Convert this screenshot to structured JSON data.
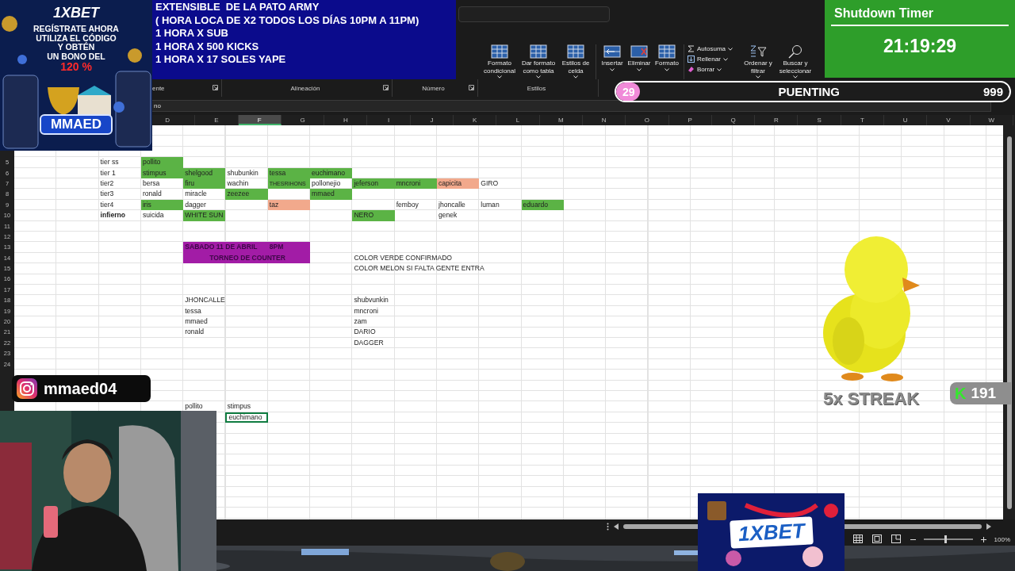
{
  "announcement": {
    "lines": [
      "EXTENSIBLE  DE LA PATO ARMY",
      "( HORA LOCA DE X2 TODOS LOS DÍAS 10PM A 11PM)",
      "1 HORA X SUB",
      "1 HORA X 500 KICKS",
      "1 HORA X 17 SOLES YAPE"
    ]
  },
  "promo_banner": {
    "logo": "1XBET",
    "lines": [
      "REGÍSTRATE AHORA",
      "UTILIZA EL CÓDIGO",
      "Y OBTÉN",
      "UN BONO DEL"
    ],
    "highlight": "120 %",
    "code": "MMAED"
  },
  "timer": {
    "title": "Shutdown Timer",
    "time": "21:19:29"
  },
  "goal_bar": {
    "count": "29",
    "label": "PUENTING",
    "goal": "999",
    "level": 0.06
  },
  "ribbon": {
    "commands": [
      {
        "kind": "grid",
        "label": "Formato condicional"
      },
      {
        "kind": "grid",
        "label": "Dar formato como tabla"
      },
      {
        "kind": "grid",
        "label": "Estilos de celda"
      },
      {
        "kind": "insert",
        "label": "Insertar"
      },
      {
        "kind": "delete",
        "label": "Eliminar"
      },
      {
        "kind": "grid",
        "label": "Formato"
      }
    ],
    "edit_items": [
      {
        "kind": "sum",
        "label": "Autosuma"
      },
      {
        "kind": "fill",
        "label": "Rellenar"
      },
      {
        "kind": "clear",
        "label": "Borrar"
      }
    ],
    "edit_commands": [
      {
        "kind": "sort",
        "label": "Ordenar y filtrar"
      },
      {
        "kind": "find",
        "label": "Buscar y seleccionar"
      }
    ],
    "groups": [
      "ente",
      "Alineación",
      "Número",
      "Estilos"
    ]
  },
  "formula_bar": {
    "value": "no"
  },
  "columns": [
    {
      "label": "D",
      "selected": false
    },
    {
      "label": "E",
      "selected": false
    },
    {
      "label": "F",
      "selected": true
    },
    {
      "label": "G",
      "selected": false
    },
    {
      "label": "H",
      "selected": false
    },
    {
      "label": "I",
      "selected": false
    },
    {
      "label": "J",
      "selected": false
    },
    {
      "label": "K",
      "selected": false
    },
    {
      "label": "L",
      "selected": false
    },
    {
      "label": "M",
      "selected": false
    },
    {
      "label": "N",
      "selected": false
    },
    {
      "label": "O",
      "selected": false
    },
    {
      "label": "P",
      "selected": false
    },
    {
      "label": "Q",
      "selected": false
    },
    {
      "label": "R",
      "selected": false
    },
    {
      "label": "S",
      "selected": false
    },
    {
      "label": "T",
      "selected": false
    },
    {
      "label": "U",
      "selected": false
    },
    {
      "label": "V",
      "selected": false
    },
    {
      "label": "W",
      "selected": false
    }
  ],
  "rows": [
    {
      "number": "5",
      "cells": [
        {
          "kind": "text",
          "text": "tier ss",
          "selected": false
        },
        {
          "kind": "text",
          "text": "pollito",
          "color": "#5bb345",
          "selected": false
        }
      ]
    },
    {
      "number": "6",
      "cells": [
        {
          "kind": "text",
          "text": "tier 1",
          "selected": false
        },
        {
          "kind": "text",
          "text": "stimpus",
          "color": "#5bb345",
          "selected": false
        },
        {
          "kind": "text",
          "text": "shelgood",
          "color": "#5bb345",
          "selected": false
        },
        {
          "kind": "text",
          "text": "shubunkin",
          "selected": false
        },
        {
          "kind": "text",
          "text": "tessa",
          "color": "#5bb345",
          "selected": false
        },
        {
          "kind": "text",
          "text": "euchimano",
          "color": "#5bb345",
          "selected": false
        }
      ]
    },
    {
      "number": "7",
      "cells": [
        {
          "kind": "text",
          "text": "tier2",
          "selected": false
        },
        {
          "kind": "text",
          "text": "bersa",
          "selected": false
        },
        {
          "kind": "text",
          "text": "firu",
          "color": "#5bb345",
          "selected": false
        },
        {
          "kind": "text",
          "text": "wachin",
          "selected": false
        },
        {
          "kind": "text",
          "text": "THESRIHONS",
          "color": "#5bb345",
          "selected": false
        },
        {
          "kind": "text",
          "text": "pollonejio",
          "selected": false
        },
        {
          "kind": "text",
          "text": "jeferson",
          "color": "#5bb345",
          "selected": false
        },
        {
          "kind": "text",
          "text": "mncroni",
          "color": "#5bb345",
          "selected": false
        },
        {
          "kind": "text",
          "text": "capicita",
          "color": "#f2a98c",
          "selected": false
        },
        {
          "kind": "text",
          "text": "GIRO",
          "selected": false
        }
      ]
    },
    {
      "number": "8",
      "cells": [
        {
          "kind": "text",
          "text": "tier3",
          "selected": false
        },
        {
          "kind": "text",
          "text": "ronald",
          "selected": false
        },
        {
          "kind": "text",
          "text": "miracle",
          "selected": false
        },
        {
          "kind": "text",
          "text": "zeezee",
          "color": "#5bb345",
          "selected": false
        },
        {
          "kind": "empty"
        },
        {
          "kind": "text",
          "text": "mmaed",
          "color": "#5bb345",
          "selected": false
        }
      ]
    },
    {
      "number": "9",
      "cells": [
        {
          "kind": "text",
          "text": "tier4",
          "selected": false
        },
        {
          "kind": "text",
          "text": "iris",
          "color": "#5bb345",
          "selected": false
        },
        {
          "kind": "text",
          "text": "dagger",
          "selected": false
        },
        {
          "kind": "empty"
        },
        {
          "kind": "text",
          "text": "taz",
          "color": "#f2a98c",
          "selected": false
        },
        {
          "kind": "empty"
        },
        {
          "kind": "empty"
        },
        {
          "kind": "text",
          "text": "femboy",
          "selected": false
        },
        {
          "kind": "text",
          "text": "jhoncalle",
          "selected": false
        },
        {
          "kind": "text",
          "text": "luman",
          "selected": false
        },
        {
          "kind": "text",
          "text": "eduardo",
          "color": "#5bb345",
          "selected": false
        }
      ]
    },
    {
      "number": "10",
      "cells": [
        {
          "kind": "text",
          "text": "infierno",
          "bold": true,
          "selected": false
        },
        {
          "kind": "text",
          "text": "suicida",
          "selected": false
        },
        {
          "kind": "text",
          "text": "WHITE SUN",
          "color": "#5bb345",
          "selected": false
        },
        {
          "kind": "empty"
        },
        {
          "kind": "empty"
        },
        {
          "kind": "empty"
        },
        {
          "kind": "text",
          "text": "NERO",
          "color": "#5bb345",
          "selected": false
        },
        {
          "kind": "empty"
        },
        {
          "kind": "text",
          "text": "genek",
          "selected": false
        }
      ]
    },
    {
      "number": "11"
    },
    {
      "number": "12"
    },
    {
      "number": "13",
      "cells": [
        {
          "kind": "empty"
        },
        {
          "kind": "empty"
        },
        {
          "kind": "double",
          "text": "SABADO 11 DE ABRIL",
          "color": "#a21ca6",
          "bold": true,
          "selected": false
        },
        {
          "kind": "text",
          "text": "8PM",
          "color": "#a21ca6",
          "bold": true,
          "selected": false
        }
      ]
    },
    {
      "number": "14",
      "cells": [
        {
          "kind": "empty"
        },
        {
          "kind": "empty"
        },
        {
          "kind": "triple",
          "text": "TORNEO DE COUNTER",
          "color": "#a21ca6",
          "bold": true,
          "selected": false
        },
        {
          "kind": "empty"
        },
        {
          "kind": "text",
          "text": "COLOR VERDE CONFIRMADO",
          "selected": false
        }
      ]
    },
    {
      "number": "15",
      "cells": [
        {
          "kind": "empty"
        },
        {
          "kind": "empty"
        },
        {
          "kind": "empty"
        },
        {
          "kind": "empty"
        },
        {
          "kind": "empty"
        },
        {
          "kind": "empty"
        },
        {
          "kind": "text",
          "text": "COLOR MELON SI FALTA GENTE ENTRA",
          "selected": false
        }
      ]
    },
    {
      "number": "16"
    },
    {
      "number": "17"
    },
    {
      "number": "18",
      "cells": [
        {
          "kind": "empty"
        },
        {
          "kind": "empty"
        },
        {
          "kind": "text",
          "text": "JHONCALLE",
          "selected": false
        },
        {
          "kind": "empty"
        },
        {
          "kind": "empty"
        },
        {
          "kind": "empty"
        },
        {
          "kind": "text",
          "text": "shubvunkin",
          "selected": false
        }
      ]
    },
    {
      "number": "19",
      "cells": [
        {
          "kind": "empty"
        },
        {
          "kind": "empty"
        },
        {
          "kind": "text",
          "text": "tessa",
          "selected": false
        },
        {
          "kind": "empty"
        },
        {
          "kind": "empty"
        },
        {
          "kind": "empty"
        },
        {
          "kind": "text",
          "text": "mncroni",
          "selected": false
        }
      ]
    },
    {
      "number": "20",
      "cells": [
        {
          "kind": "empty"
        },
        {
          "kind": "empty"
        },
        {
          "kind": "text",
          "text": "mmaed",
          "selected": false
        },
        {
          "kind": "empty"
        },
        {
          "kind": "empty"
        },
        {
          "kind": "empty"
        },
        {
          "kind": "text",
          "text": "zam",
          "selected": false
        }
      ]
    },
    {
      "number": "21",
      "cells": [
        {
          "kind": "empty"
        },
        {
          "kind": "empty"
        },
        {
          "kind": "text",
          "text": "ronald",
          "selected": false
        },
        {
          "kind": "empty"
        },
        {
          "kind": "empty"
        },
        {
          "kind": "empty"
        },
        {
          "kind": "text",
          "text": "DARIO",
          "selected": false
        }
      ]
    },
    {
      "number": "22",
      "cells": [
        {
          "kind": "empty"
        },
        {
          "kind": "empty"
        },
        {
          "kind": "empty"
        },
        {
          "kind": "empty"
        },
        {
          "kind": "empty"
        },
        {
          "kind": "empty"
        },
        {
          "kind": "text",
          "text": "DAGGER",
          "selected": false
        }
      ]
    },
    {
      "number": "23"
    },
    {
      "number": "24"
    },
    {},
    {},
    {},
    {
      "cells": [
        {
          "kind": "empty"
        },
        {
          "kind": "empty"
        },
        {
          "kind": "text",
          "text": "pollito",
          "selected": false
        },
        {
          "kind": "text",
          "text": "stimpus",
          "selected": false
        }
      ]
    },
    {
      "cells": [
        {
          "kind": "empty"
        },
        {
          "kind": "empty"
        },
        {
          "kind": "empty"
        },
        {
          "kind": "text",
          "text": "euchimano",
          "selected": true
        }
      ]
    }
  ],
  "instagram": {
    "handle": "mmaed04"
  },
  "streak": {
    "label": "5x STREAK",
    "mark": "K",
    "count": "191"
  },
  "bottom_ad": {
    "logo": "1XBET"
  },
  "status_bar": {
    "zoom": "100%",
    "level": 0.45
  }
}
